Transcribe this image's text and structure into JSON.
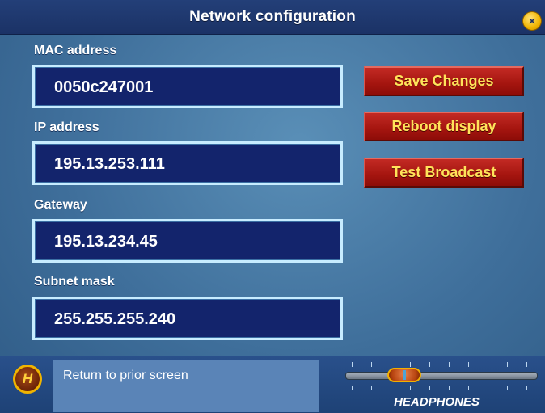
{
  "window": {
    "title": "Network configuration",
    "close_symbol": "×"
  },
  "fields": [
    {
      "label": "MAC address",
      "value": "0050c247001"
    },
    {
      "label": "IP address",
      "value": "195.13.253.111"
    },
    {
      "label": "Gateway",
      "value": "195.13.234.45"
    },
    {
      "label": "Subnet mask",
      "value": "255.255.255.240"
    }
  ],
  "actions": {
    "save": "Save Changes",
    "reboot": "Reboot display",
    "test": "Test Broadcast"
  },
  "footer": {
    "home_glyph": "H",
    "status": "Return to prior screen"
  },
  "volume": {
    "label": "HEADPHONES",
    "level": 0.27
  },
  "colors": {
    "title_bar": "#1b3266",
    "field_fill": "#13246c",
    "field_border": "#c7ecff",
    "button_red": "#a4150f",
    "button_text": "#ffe35a",
    "accent_gold": "#f0b400"
  }
}
